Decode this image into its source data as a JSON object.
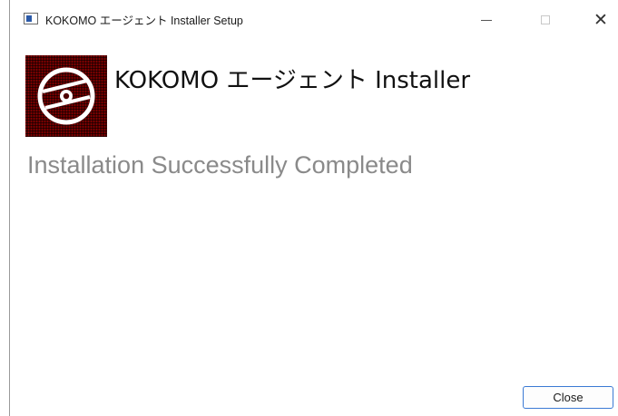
{
  "window": {
    "title": "KOKOMO エージェント Installer Setup",
    "controls": {
      "minimize_icon": "minimize-icon",
      "maximize_icon": "maximize-icon",
      "close_icon": "close-icon",
      "close_glyph": "✕"
    }
  },
  "header": {
    "logo_icon": "disc-icon",
    "title": "KOKOMO エージェント Installer"
  },
  "main": {
    "status_text": "Installation Successfully Completed"
  },
  "footer": {
    "close_label": "Close"
  },
  "colors": {
    "accent": "#3b7ad4",
    "logo_background": "#4d0000",
    "status_text": "#8a8a8a"
  }
}
